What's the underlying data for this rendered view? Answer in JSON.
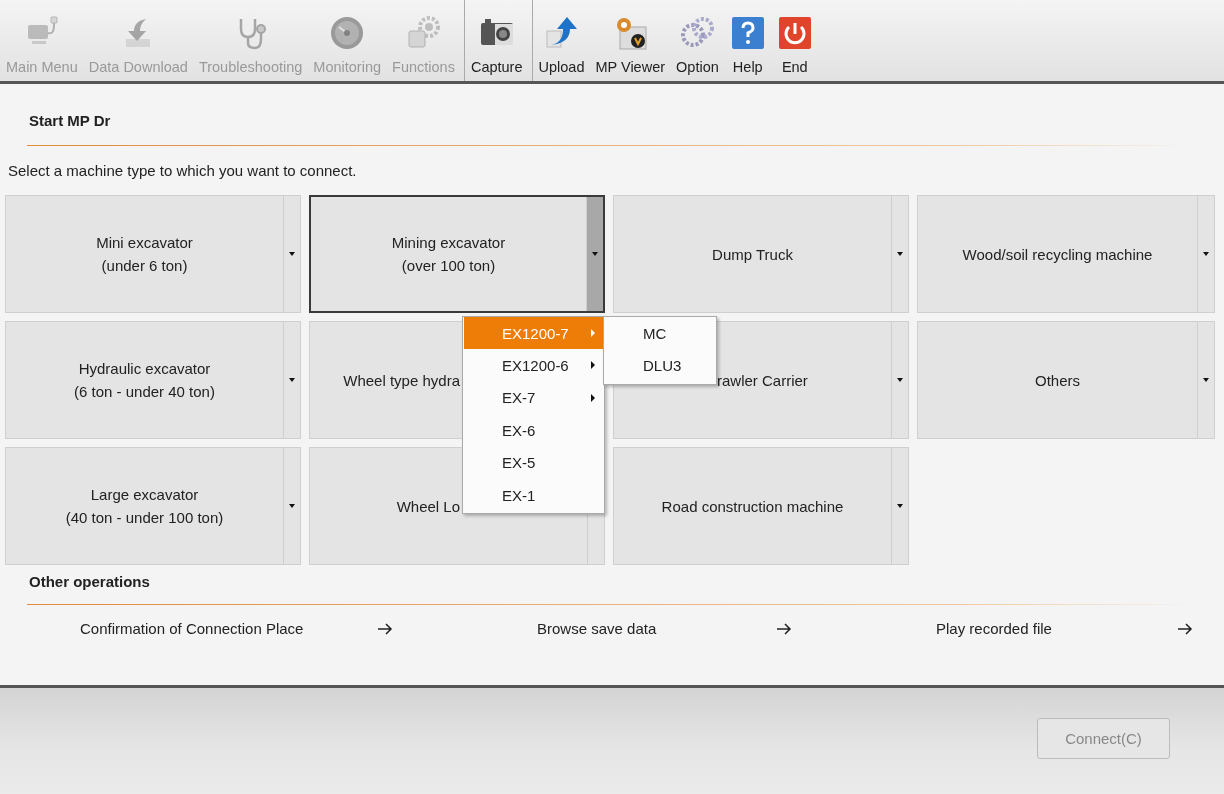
{
  "toolbar": [
    {
      "label": "Main Menu",
      "disabled": true
    },
    {
      "label": "Data Download",
      "disabled": true
    },
    {
      "label": "Troubleshooting",
      "disabled": true
    },
    {
      "label": "Monitoring",
      "disabled": true
    },
    {
      "label": "Functions",
      "disabled": true
    },
    {
      "label": "Capture",
      "disabled": false
    },
    {
      "label": "Upload",
      "disabled": false
    },
    {
      "label": "MP Viewer",
      "disabled": false
    },
    {
      "label": "Option",
      "disabled": false
    },
    {
      "label": "Help",
      "disabled": false
    },
    {
      "label": "End",
      "disabled": false
    }
  ],
  "section_title": "Start MP Dr",
  "instruction": "Select a machine type to which you want to connect.",
  "machine_types": [
    {
      "lines": [
        "Mini excavator",
        "(under 6 ton)"
      ],
      "selected": false,
      "kind": "whole"
    },
    {
      "lines": [
        "Mining excavator",
        "(over 100 ton)"
      ],
      "selected": true,
      "kind": "whole"
    },
    {
      "lines": [
        "Dump Truck"
      ],
      "selected": false,
      "kind": "whole"
    },
    {
      "lines": [
        "Wood/soil recycling machine"
      ],
      "selected": false,
      "kind": "whole"
    },
    {
      "lines": [
        "Hydraulic excavator",
        "(6 ton - under 40 ton)"
      ],
      "selected": false,
      "kind": "whole"
    },
    {
      "lines": [
        "Wheel type hydra"
      ],
      "selected": false,
      "kind": "covered"
    },
    {
      "lines": [
        "rawler Carrier"
      ],
      "selected": false,
      "kind": "cutleft"
    },
    {
      "lines": [
        "Others"
      ],
      "selected": false,
      "kind": "whole"
    },
    {
      "lines": [
        "Large excavator",
        "(40 ton - under 100 ton)"
      ],
      "selected": false,
      "kind": "whole"
    },
    {
      "lines": [
        "Wheel Lo"
      ],
      "selected": false,
      "kind": "cutright"
    },
    {
      "lines": [
        "Road construction machine"
      ],
      "selected": false,
      "kind": "whole"
    }
  ],
  "model_menu": [
    {
      "label": "EX1200-7",
      "selected": true,
      "has_submenu": true
    },
    {
      "label": "EX1200-6",
      "selected": false,
      "has_submenu": true
    },
    {
      "label": "EX-7",
      "selected": false,
      "has_submenu": true
    },
    {
      "label": "EX-6",
      "selected": false,
      "has_submenu": false
    },
    {
      "label": "EX-5",
      "selected": false,
      "has_submenu": false
    },
    {
      "label": "EX-1",
      "selected": false,
      "has_submenu": false
    }
  ],
  "submenu": [
    {
      "label": "MC",
      "selected": false
    },
    {
      "label": "DLU3",
      "selected": false
    }
  ],
  "other_title": "Other operations",
  "other_operations": [
    "Confirmation of Connection Place",
    "Browse save data",
    "Play recorded file"
  ],
  "connect_button": {
    "label": "Connect(C)",
    "disabled": true
  }
}
